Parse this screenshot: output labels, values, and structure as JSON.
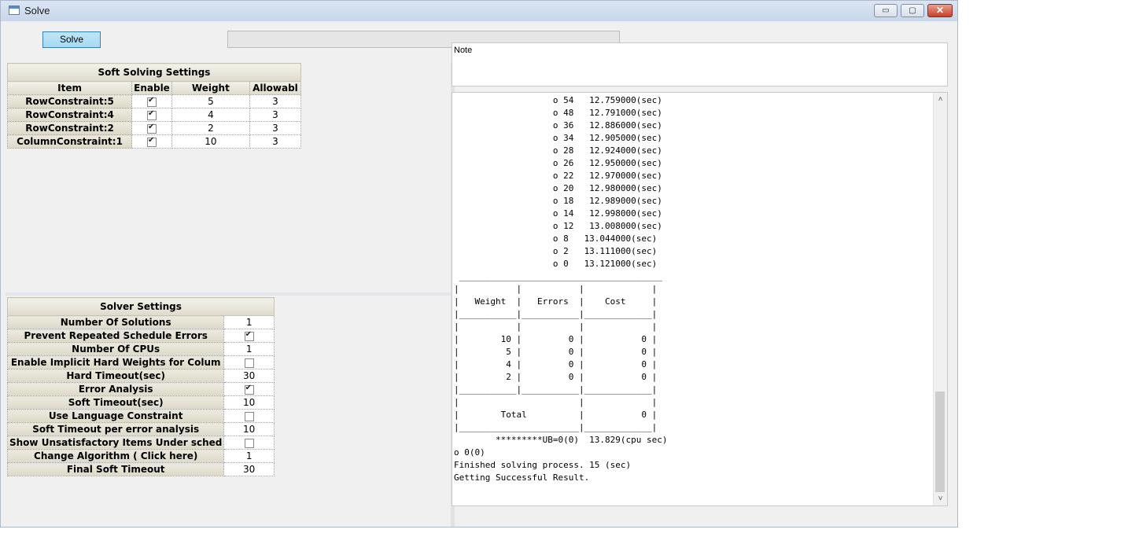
{
  "window": {
    "title": "Solve",
    "min_glyph": "▭",
    "max_glyph": "▢",
    "close_glyph": "✕"
  },
  "toolbar": {
    "solve_label": "Solve"
  },
  "soft_settings": {
    "title": "Soft Solving Settings",
    "columns": [
      "Item",
      "Enable",
      "Weight",
      "Allowabl"
    ],
    "rows": [
      {
        "item": "RowConstraint:5",
        "enable": true,
        "weight": "5",
        "allowable": "3"
      },
      {
        "item": "RowConstraint:4",
        "enable": true,
        "weight": "4",
        "allowable": "3"
      },
      {
        "item": "RowConstraint:2",
        "enable": true,
        "weight": "2",
        "allowable": "3"
      },
      {
        "item": "ColumnConstraint:1",
        "enable": true,
        "weight": "10",
        "allowable": "3"
      }
    ]
  },
  "solver_settings": {
    "title": "Solver Settings",
    "rows": [
      {
        "label": "Number Of Solutions",
        "type": "text",
        "value": "1"
      },
      {
        "label": "Prevent Repeated Schedule Errors",
        "type": "check",
        "checked": true
      },
      {
        "label": "Number Of CPUs",
        "type": "text",
        "value": "1"
      },
      {
        "label": "Enable Implicit Hard Weights for Colum",
        "type": "check",
        "checked": false
      },
      {
        "label": "Hard Timeout(sec)",
        "type": "text",
        "value": "30"
      },
      {
        "label": "Error Analysis",
        "type": "check",
        "checked": true
      },
      {
        "label": "Soft Timeout(sec)",
        "type": "text",
        "value": "10"
      },
      {
        "label": "Use Language Constraint",
        "type": "check",
        "checked": false
      },
      {
        "label": "Soft Timeout per error analysis",
        "type": "text",
        "value": "10"
      },
      {
        "label": "Show Unsatisfactory Items Under sched",
        "type": "check",
        "checked": false
      },
      {
        "label": "Change Algorithm ( Click here)",
        "type": "text",
        "value": "1"
      },
      {
        "label": "Final Soft Timeout",
        "type": "text",
        "value": "30"
      }
    ]
  },
  "note": {
    "label": "Note"
  },
  "output": {
    "lines": [
      "                   o 54   12.759000(sec)",
      "                   o 48   12.791000(sec)",
      "                   o 36   12.886000(sec)",
      "                   o 34   12.905000(sec)",
      "                   o 28   12.924000(sec)",
      "                   o 26   12.950000(sec)",
      "                   o 22   12.970000(sec)",
      "                   o 20   12.980000(sec)",
      "                   o 18   12.989000(sec)",
      "                   o 14   12.998000(sec)",
      "                   o 12   13.008000(sec)",
      "                   o 8   13.044000(sec)",
      "                   o 2   13.111000(sec)",
      "                   o 0   13.121000(sec)",
      " _______________________________________",
      "|           |           |             |",
      "|   Weight  |   Errors  |    Cost     |",
      "|___________|___________|_____________|",
      "|           |           |             |",
      "|        10 |         0 |           0 |",
      "|         5 |         0 |           0 |",
      "|         4 |         0 |           0 |",
      "|         2 |         0 |           0 |",
      "|___________|___________|_____________|",
      "|                       |             |",
      "|        Total          |           0 |",
      "|_______________________|_____________|",
      "        *********UB=0(0)  13.829(cpu sec)",
      "o 0(0)",
      "Finished solving process. 15 (sec)",
      "Getting Successful Result."
    ]
  }
}
